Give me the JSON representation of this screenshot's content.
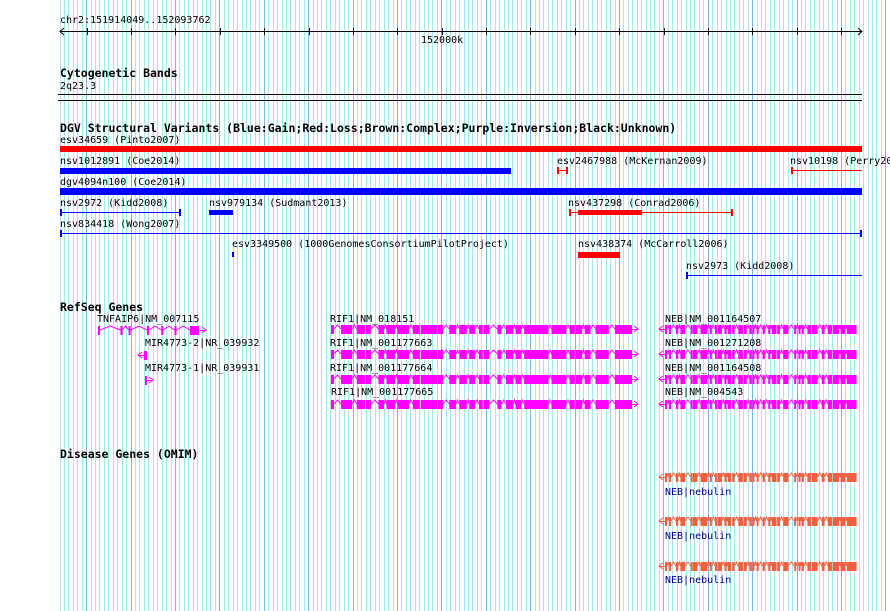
{
  "ruler": {
    "location": "chr2:151914049..152093762",
    "tick_label": "152000k"
  },
  "colors": {
    "grid_minor": "#a8e8ec",
    "grid_major": "#7fb2e6",
    "gain": "#0000ff",
    "loss": "#ff0000",
    "refseq": "#ff00ff",
    "omim_glyph": "#f06040",
    "omim_label": "#00008b"
  },
  "tracks": {
    "cytoband": {
      "title": "Cytogenetic Bands",
      "band": "2q23.3"
    },
    "dgv": {
      "title": "DGV Structural Variants (Blue:Gain;Red:Loss;Brown:Complex;Purple:Inversion;Black:Unknown)",
      "features": [
        {
          "label": "esv34659 (Pinto2007)",
          "type": "loss"
        },
        {
          "label": "nsv1012891 (Coe2014)",
          "type": "gain"
        },
        {
          "label": "esv2467988 (McKernan2009)",
          "type": "loss"
        },
        {
          "label": "nsv10198 (Perry20",
          "type": "loss"
        },
        {
          "label": "dgv4094n100 (Coe2014)",
          "type": "gain"
        },
        {
          "label": "nsv2972 (Kidd2008)",
          "type": "gain"
        },
        {
          "label": "nsv979134 (Sudmant2013)",
          "type": "gain"
        },
        {
          "label": "nsv437298 (Conrad2006)",
          "type": "loss"
        },
        {
          "label": "nsv834418 (Wong2007)",
          "type": "gain"
        },
        {
          "label": "esv3349500 (1000GenomesConsortiumPilotProject)",
          "type": "gain"
        },
        {
          "label": "nsv438374 (McCarroll2006)",
          "type": "loss"
        },
        {
          "label": "nsv2973 (Kidd2008)",
          "type": "gain"
        }
      ]
    },
    "refseq": {
      "title": "RefSeq Genes",
      "genes": [
        {
          "label": "TNFAIP6|NM_007115",
          "strand": "+"
        },
        {
          "label": "MIR4773-2|NR_039932",
          "strand": "-"
        },
        {
          "label": "MIR4773-1|NR_039931",
          "strand": "+"
        },
        {
          "label": "RIF1|NM_018151",
          "strand": "+"
        },
        {
          "label": "RIF1|NM_001177663",
          "strand": "+"
        },
        {
          "label": "RIF1|NM_001177664",
          "strand": "+"
        },
        {
          "label": "RIF1|NM_001177665",
          "strand": "+"
        },
        {
          "label": "NEB|NM_001164507",
          "strand": "-"
        },
        {
          "label": "NEB|NM_001271208",
          "strand": "-"
        },
        {
          "label": "NEB|NM_001164508",
          "strand": "-"
        },
        {
          "label": "NEB|NM_004543",
          "strand": "-"
        }
      ]
    },
    "omim": {
      "title": "Disease Genes (OMIM)",
      "genes": [
        {
          "label": "NEB|nebulin",
          "strand": "-"
        },
        {
          "label": "NEB|nebulin",
          "strand": "-"
        },
        {
          "label": "NEB|nebulin",
          "strand": "-"
        }
      ]
    }
  }
}
